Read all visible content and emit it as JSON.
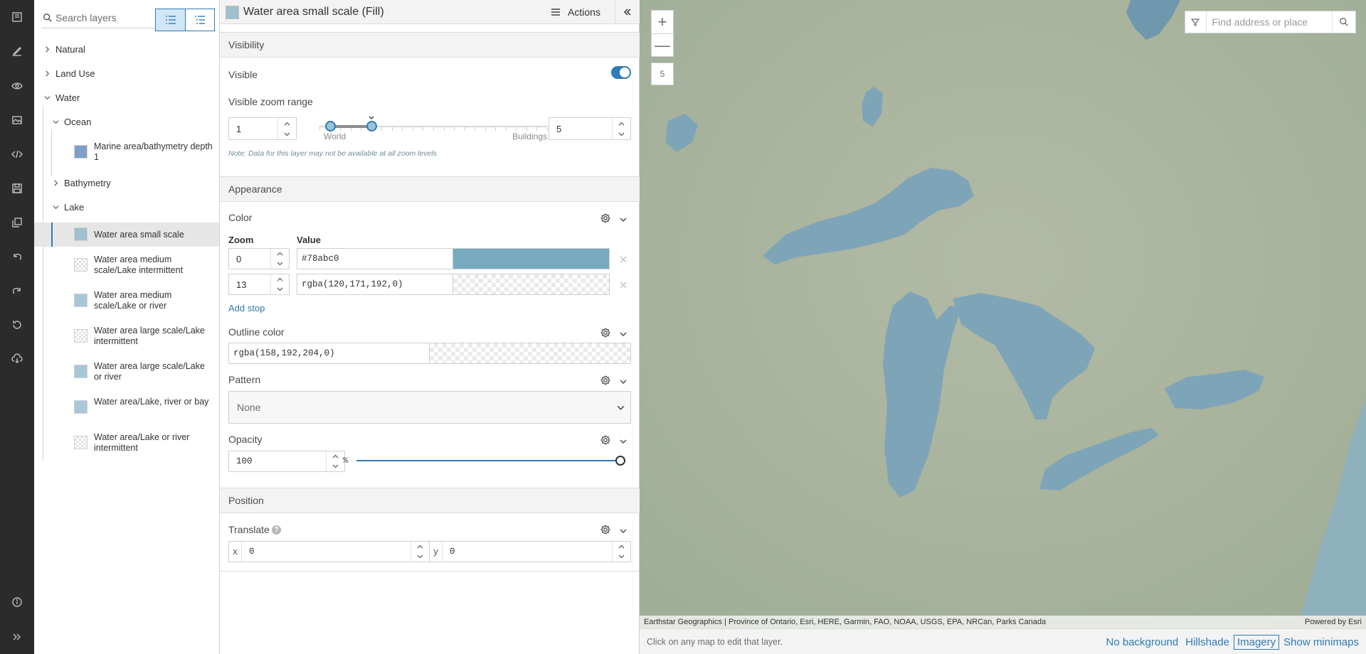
{
  "toolbar": {
    "items": [
      {
        "name": "book-icon"
      },
      {
        "name": "edit-icon"
      },
      {
        "name": "eye-icon"
      },
      {
        "name": "image-icon"
      },
      {
        "name": "code-icon"
      },
      {
        "name": "save-icon"
      },
      {
        "name": "copy-icon"
      },
      {
        "name": "undo-icon"
      },
      {
        "name": "redo-icon"
      },
      {
        "name": "reset-icon"
      },
      {
        "name": "download-icon"
      }
    ],
    "bottom": [
      {
        "name": "info-icon"
      },
      {
        "name": "expand-icon"
      }
    ]
  },
  "layers": {
    "search_placeholder": "Search layers",
    "groups": {
      "natural": "Natural",
      "land_use": "Land Use",
      "water": "Water",
      "ocean": "Ocean",
      "bathymetry": "Bathymetry",
      "lake": "Lake"
    },
    "ocean_items": [
      {
        "label": "Marine area/bathymetry depth 1",
        "color": "#7f9fc8"
      }
    ],
    "lake_items": [
      {
        "label": "Water area small scale",
        "color": "#9ec0cf",
        "selected": true
      },
      {
        "label": "Water area medium scale/Lake intermittent",
        "transparent": true
      },
      {
        "label": "Water area medium scale/Lake or river",
        "color": "#a8c8d8"
      },
      {
        "label": "Water area large scale/Lake intermittent",
        "transparent": true
      },
      {
        "label": "Water area large scale/Lake or river",
        "color": "#a8c8d8"
      },
      {
        "label": "Water area/Lake, river or bay",
        "color": "#a8c8d8"
      },
      {
        "label": "Water area/Lake or river intermittent",
        "transparent": true
      }
    ]
  },
  "props": {
    "title": "Water area small scale (Fill)",
    "actions_label": "Actions",
    "visibility": {
      "section": "Visibility",
      "visible_label": "Visible",
      "visible": true,
      "zoom_range_label": "Visible zoom range",
      "min_zoom": "1",
      "max_zoom": "5",
      "world_label": "World",
      "buildings_label": "Buildings",
      "note": "Note: Data for this layer may not be available at all zoom levels"
    },
    "appearance": {
      "section": "Appearance",
      "color_label": "Color",
      "zoom_header": "Zoom",
      "value_header": "Value",
      "stops": [
        {
          "zoom": "0",
          "value": "#78abc0",
          "swatch": "#78abc0"
        },
        {
          "zoom": "13",
          "value": "rgba(120,171,192,0)",
          "transparent": true
        }
      ],
      "add_stop": "Add stop",
      "outline_label": "Outline color",
      "outline_value": "rgba(158,192,204,0)",
      "pattern_label": "Pattern",
      "pattern_value": "None",
      "opacity_label": "Opacity",
      "opacity_value": "100",
      "opacity_unit": "%"
    },
    "position": {
      "section": "Position",
      "translate_label": "Translate",
      "help": "?",
      "x_label": "x",
      "x_value": "0",
      "y_label": "y",
      "y_value": "0"
    }
  },
  "map": {
    "zoom_in": "+",
    "zoom_out": "—",
    "zoom_level": "5",
    "search_placeholder": "Find address or place",
    "attribution": "Earthstar Geographics | Province of Ontario, Esri, HERE, Garmin, FAO, NOAA, USGS, EPA, NRCan, Parks Canada",
    "powered_by": "Powered by Esri",
    "footer_hint": "Click on any map to edit that layer.",
    "backgrounds": [
      {
        "label": "No background",
        "active": false
      },
      {
        "label": "Hillshade",
        "active": false
      },
      {
        "label": "Imagery",
        "active": true
      },
      {
        "label": "Show minimaps",
        "active": false
      }
    ],
    "water_color": "#7ea4b8",
    "land_color": "#aab59e"
  }
}
